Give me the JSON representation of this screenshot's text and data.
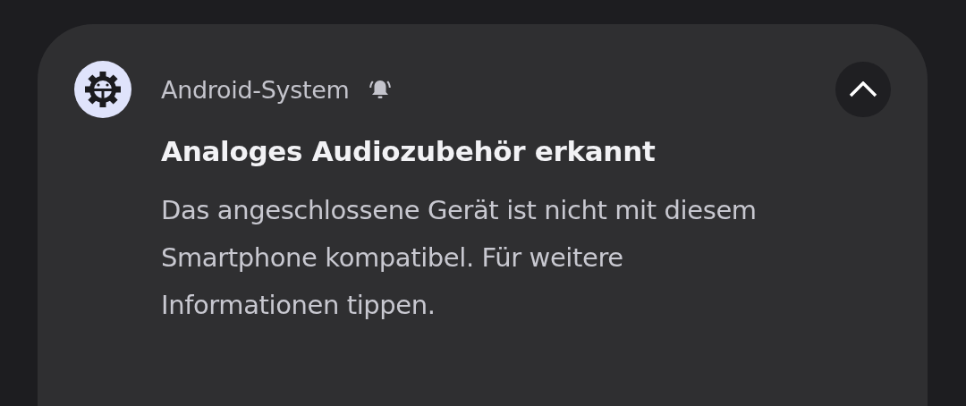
{
  "notification": {
    "app_name": "Android-System",
    "alerting": true,
    "expanded": true,
    "title": "Analoges Audiozubehör erkannt",
    "body": "Das angeschlossene Gerät ist nicht mit diesem Smartphone kompatibel. Für weitere Informationen tippen."
  }
}
